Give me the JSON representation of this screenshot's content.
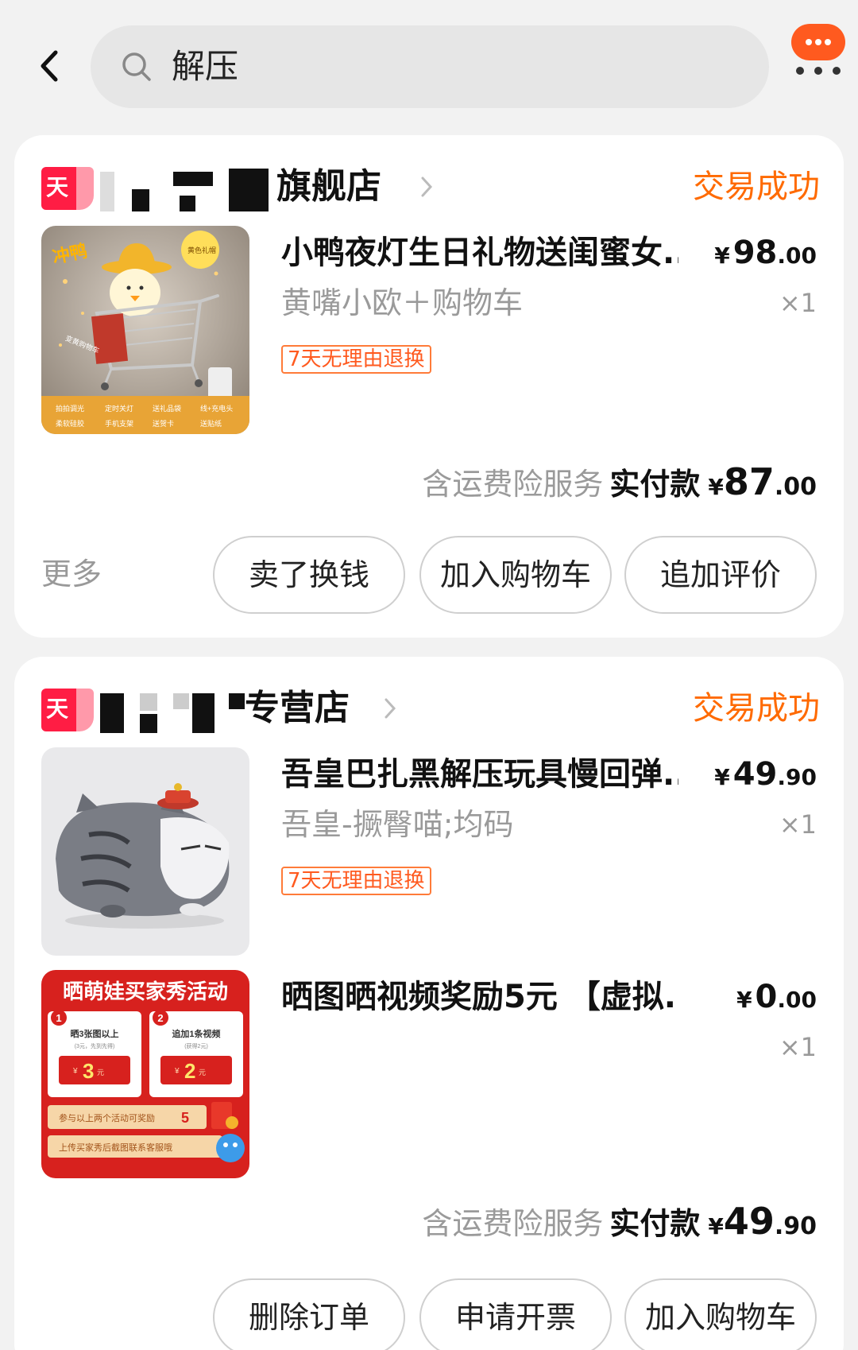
{
  "search": {
    "query": "解压"
  },
  "orders": [
    {
      "shop_badge": "天",
      "shop_name_suffix": "旗舰店",
      "status": "交易成功",
      "items": [
        {
          "title": "小鸭夜灯生日礼物送闺蜜女...",
          "price_currency": "¥",
          "price_int": "98",
          "price_dec": ".00",
          "sku": "黄嘴小欧＋购物车",
          "qty": "×1",
          "tag": "7天无理由退换",
          "thumb_text": {
            "brand": "冲鸭",
            "badge": "黄色礼帽",
            "sticker": "变黄购物车",
            "features": [
              "拍拍调光",
              "定时关灯",
              "送礼品袋",
              "线+充电头",
              "柔软硅胶",
              "手机支架",
              "送贺卡",
              "送贴纸"
            ]
          }
        }
      ],
      "service": "含运费险服务",
      "paid_label": "实付款",
      "paid_currency": "¥",
      "paid_int": "87",
      "paid_dec": ".00",
      "more": "更多",
      "buttons": [
        "卖了换钱",
        "加入购物车",
        "追加评价"
      ]
    },
    {
      "shop_badge": "天",
      "shop_name_suffix": "专营店",
      "status": "交易成功",
      "items": [
        {
          "title": "吾皇巴扎黑解压玩具慢回弹...",
          "price_currency": "¥",
          "price_int": "49",
          "price_dec": ".90",
          "sku": "吾皇-撅臀喵;均码",
          "qty": "×1",
          "tag": "7天无理由退换"
        },
        {
          "title": "晒图晒视频奖励5元 【虚拟...",
          "price_currency": "¥",
          "price_int": "0",
          "price_dec": ".00",
          "qty": "×1",
          "thumb_text": {
            "headline": "晒萌娃买家秀活动",
            "step1_no": "1",
            "step1_title": "晒3张图以上",
            "step1_note": "(3元，先到先得)",
            "step1_amount": "3",
            "step2_no": "2",
            "step2_title": "追加1条视频",
            "step2_note": "(获得2元)",
            "step2_amount": "2",
            "currency": "¥",
            "unit": "元",
            "combo": "参与以上两个活动可奖励",
            "combo_amount": "5",
            "footer": "上传买家秀后截图联系客服哦"
          }
        }
      ],
      "service": "含运费险服务",
      "paid_label": "实付款",
      "paid_currency": "¥",
      "paid_int": "49",
      "paid_dec": ".90",
      "buttons": [
        "删除订单",
        "申请开票",
        "加入购物车"
      ]
    }
  ],
  "colors": {
    "accent": "#ff6a00",
    "tmall_red": "#ff1d44",
    "gray_text": "#9a9a9a"
  }
}
